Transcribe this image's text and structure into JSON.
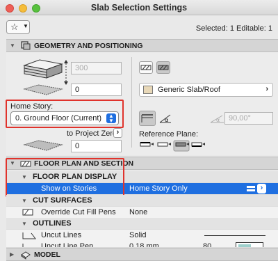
{
  "window": {
    "title": "Slab Selection Settings"
  },
  "header": {
    "favorites_icon": "star-icon",
    "selection_info": "Selected: 1 Editable: 1"
  },
  "sections": {
    "geometry": "GEOMETRY AND POSITIONING",
    "floor_plan": "FLOOR PLAN AND SECTION",
    "model": "MODEL"
  },
  "geometry": {
    "thickness": "300",
    "offset_top": "0",
    "offset_bottom": "0",
    "home_story_label": "Home Story:",
    "home_story_value": "0. Ground Floor (Current)",
    "to_project_zero": "to Project Zero",
    "surface": "Generic Slab/Roof",
    "angle": "90,00°",
    "reference_plane_label": "Reference Plane:"
  },
  "floor_plan": {
    "display_group": "FLOOR PLAN DISPLAY",
    "show_on_stories_label": "Show on Stories",
    "show_on_stories_value": "Home Story Only",
    "cut_surfaces_group": "CUT SURFACES",
    "override_pens_label": "Override Cut Fill Pens",
    "override_pens_value": "None",
    "outlines_group": "OUTLINES",
    "uncut_lines_label": "Uncut Lines",
    "uncut_lines_value": "Solid",
    "uncut_pen_label": "Uncut Line Pen",
    "uncut_pen_value": "0,18 mm",
    "uncut_pen_number": "80"
  },
  "colors": {
    "accent": "#1f6fe0",
    "highlight": "#e0332c"
  }
}
